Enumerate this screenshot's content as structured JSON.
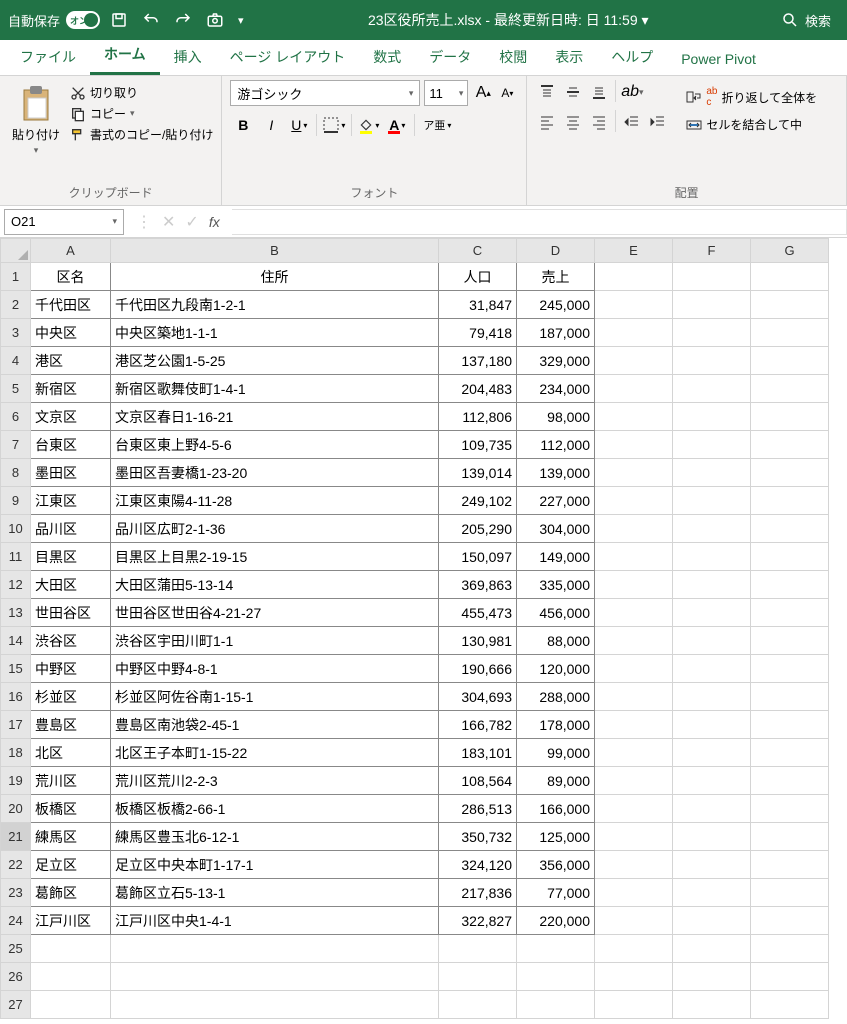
{
  "title_bar": {
    "autosave_label": "自動保存",
    "toggle_text": "オン",
    "filename": "23区役所売上.xlsx - 最終更新日時: 日 11:59 ▾",
    "search_label": "検索"
  },
  "tabs": [
    {
      "label": "ファイル"
    },
    {
      "label": "ホーム",
      "active": true
    },
    {
      "label": "挿入"
    },
    {
      "label": "ページ レイアウト"
    },
    {
      "label": "数式"
    },
    {
      "label": "データ"
    },
    {
      "label": "校閲"
    },
    {
      "label": "表示"
    },
    {
      "label": "ヘルプ"
    },
    {
      "label": "Power Pivot"
    }
  ],
  "ribbon": {
    "clipboard": {
      "paste_label": "貼り付け",
      "cut_label": "切り取り",
      "copy_label": "コピー",
      "format_painter_label": "書式のコピー/貼り付け",
      "group_label": "クリップボード"
    },
    "font": {
      "font_name": "游ゴシック",
      "font_size": "11",
      "ruby_label": "ア亜",
      "group_label": "フォント"
    },
    "alignment": {
      "wrap_label": "折り返して全体を",
      "merge_label": "セルを結合して中",
      "group_label": "配置"
    }
  },
  "formula_bar": {
    "name_box": "O21",
    "fx_label": "fx"
  },
  "columns": [
    "A",
    "B",
    "C",
    "D",
    "E",
    "F",
    "G"
  ],
  "headers": [
    "区名",
    "住所",
    "人口",
    "売上"
  ],
  "rows": [
    {
      "n": 1
    },
    {
      "n": 2,
      "a": "千代田区",
      "b": "千代田区九段南1-2-1",
      "c": "31,847",
      "d": "245,000"
    },
    {
      "n": 3,
      "a": "中央区",
      "b": "中央区築地1-1-1",
      "c": "79,418",
      "d": "187,000"
    },
    {
      "n": 4,
      "a": "港区",
      "b": "港区芝公園1-5-25",
      "c": "137,180",
      "d": "329,000"
    },
    {
      "n": 5,
      "a": "新宿区",
      "b": "新宿区歌舞伎町1-4-1",
      "c": "204,483",
      "d": "234,000"
    },
    {
      "n": 6,
      "a": "文京区",
      "b": "文京区春日1-16-21",
      "c": "112,806",
      "d": "98,000"
    },
    {
      "n": 7,
      "a": "台東区",
      "b": "台東区東上野4-5-6",
      "c": "109,735",
      "d": "112,000"
    },
    {
      "n": 8,
      "a": "墨田区",
      "b": "墨田区吾妻橋1-23-20",
      "c": "139,014",
      "d": "139,000"
    },
    {
      "n": 9,
      "a": "江東区",
      "b": "江東区東陽4-11-28",
      "c": "249,102",
      "d": "227,000"
    },
    {
      "n": 10,
      "a": "品川区",
      "b": "品川区広町2-1-36",
      "c": "205,290",
      "d": "304,000"
    },
    {
      "n": 11,
      "a": "目黒区",
      "b": "目黒区上目黒2-19-15",
      "c": "150,097",
      "d": "149,000"
    },
    {
      "n": 12,
      "a": "大田区",
      "b": "大田区蒲田5-13-14",
      "c": "369,863",
      "d": "335,000"
    },
    {
      "n": 13,
      "a": "世田谷区",
      "b": "世田谷区世田谷4-21-27",
      "c": "455,473",
      "d": "456,000"
    },
    {
      "n": 14,
      "a": "渋谷区",
      "b": "渋谷区宇田川町1-1",
      "c": "130,981",
      "d": "88,000"
    },
    {
      "n": 15,
      "a": "中野区",
      "b": "中野区中野4-8-1",
      "c": "190,666",
      "d": "120,000"
    },
    {
      "n": 16,
      "a": "杉並区",
      "b": "杉並区阿佐谷南1-15-1",
      "c": "304,693",
      "d": "288,000"
    },
    {
      "n": 17,
      "a": "豊島区",
      "b": "豊島区南池袋2-45-1",
      "c": "166,782",
      "d": "178,000"
    },
    {
      "n": 18,
      "a": "北区",
      "b": "北区王子本町1-15-22",
      "c": "183,101",
      "d": "99,000"
    },
    {
      "n": 19,
      "a": "荒川区",
      "b": "荒川区荒川2-2-3",
      "c": "108,564",
      "d": "89,000"
    },
    {
      "n": 20,
      "a": "板橋区",
      "b": "板橋区板橋2-66-1",
      "c": "286,513",
      "d": "166,000"
    },
    {
      "n": 21,
      "a": "練馬区",
      "b": "練馬区豊玉北6-12-1",
      "c": "350,732",
      "d": "125,000",
      "active_row": true
    },
    {
      "n": 22,
      "a": "足立区",
      "b": "足立区中央本町1-17-1",
      "c": "324,120",
      "d": "356,000"
    },
    {
      "n": 23,
      "a": "葛飾区",
      "b": "葛飾区立石5-13-1",
      "c": "217,836",
      "d": "77,000"
    },
    {
      "n": 24,
      "a": "江戸川区",
      "b": "江戸川区中央1-4-1",
      "c": "322,827",
      "d": "220,000"
    },
    {
      "n": 25
    },
    {
      "n": 26
    },
    {
      "n": 27
    }
  ]
}
